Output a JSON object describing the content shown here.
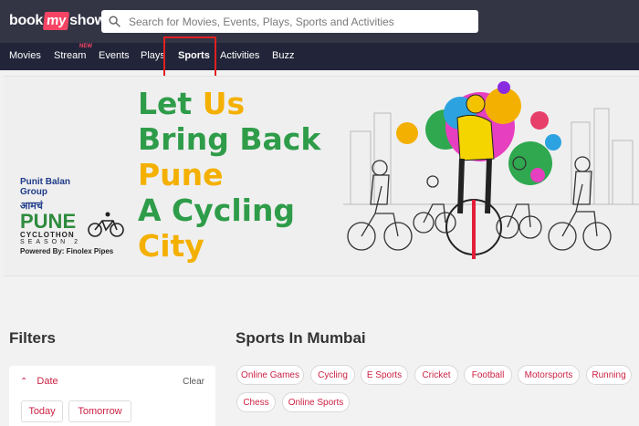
{
  "header": {
    "logo": {
      "part1": "book",
      "part2": "my",
      "part3": "show"
    },
    "search": {
      "placeholder": "Search for Movies, Events, Plays, Sports and Activities",
      "value": ""
    }
  },
  "nav": {
    "items": [
      {
        "label": "Movies"
      },
      {
        "label": "Stream",
        "badge": "NEW"
      },
      {
        "label": "Events"
      },
      {
        "label": "Plays"
      },
      {
        "label": "Sports",
        "active": true
      },
      {
        "label": "Activities"
      },
      {
        "label": "Buzz"
      }
    ]
  },
  "banner": {
    "headline": [
      "Let Us",
      "Bring Back",
      "Pune",
      "A Cycling",
      "City"
    ],
    "sponsor": [
      "Punit Balan",
      "Group"
    ],
    "marathi": "आमचं",
    "event_name": "PUNE",
    "event_sub": "CYCLOTHON",
    "season": "SEASON 2",
    "powered_by": "Powered By: Finolex Pipes",
    "colors": {
      "green": "#2e9c49",
      "yellow": "#f4b000"
    }
  },
  "filters": {
    "title": "Filters",
    "date": {
      "label": "Date",
      "clear": "Clear",
      "options": [
        "Today",
        "Tomorrow"
      ]
    }
  },
  "sports": {
    "title": "Sports In Mumbai",
    "categories": [
      "Online Games",
      "Cycling",
      "E Sports",
      "Cricket",
      "Football",
      "Motorsports",
      "Running",
      "Chess",
      "Online Sports"
    ]
  },
  "colors": {
    "accent": "#f84464",
    "chip_text": "#cc2244",
    "topbar": "#333545",
    "navbar": "#222539"
  }
}
